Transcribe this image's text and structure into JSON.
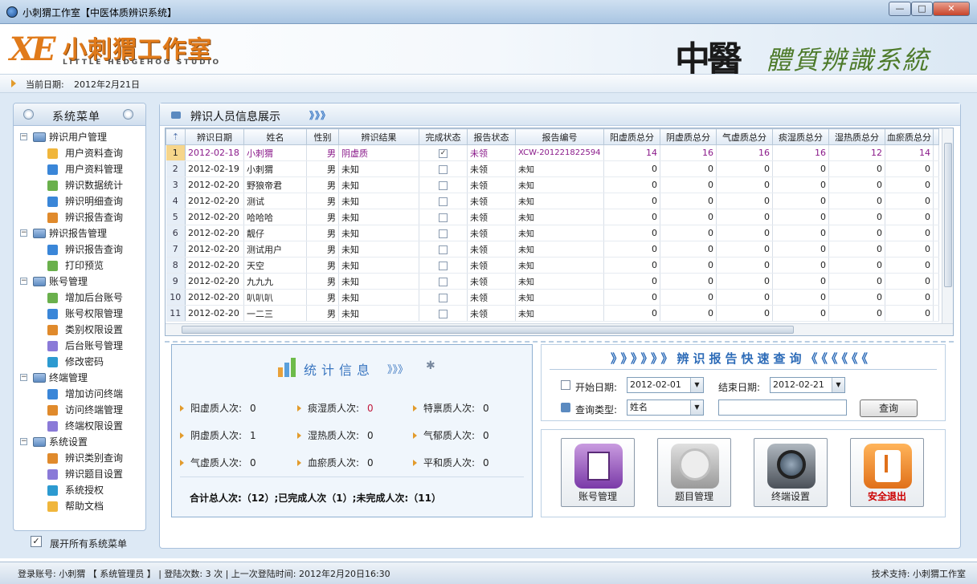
{
  "window": {
    "title": "小刺猬工作室【中医体质辨识系统】",
    "min": "—",
    "max": "□",
    "close": "✕"
  },
  "header": {
    "logo_mark": "XE",
    "logo_cn": "小刺猬工作室",
    "logo_en": "LITTLE HEDGEHOG STUDIO",
    "brand_1": "中醫",
    "brand_2": "體質辨識系統"
  },
  "datebar": {
    "label": "当前日期:",
    "value": "2012年2月21日"
  },
  "sidebar": {
    "title": "系统菜单",
    "groups": [
      {
        "label": "辨识用户管理",
        "items": [
          "用户资料查询",
          "用户资料管理",
          "辨识数据统计",
          "辨识明细查询",
          "辨识报告查询"
        ]
      },
      {
        "label": "辨识报告管理",
        "items": [
          "辨识报告查询",
          "打印预览"
        ]
      },
      {
        "label": "账号管理",
        "items": [
          "增加后台账号",
          "账号权限管理",
          "类别权限设置",
          "后台账号管理",
          "修改密码"
        ]
      },
      {
        "label": "终端管理",
        "items": [
          "增加访问终端",
          "访问终端管理",
          "终端权限设置"
        ]
      },
      {
        "label": "系统设置",
        "items": [
          "辨识类别查询",
          "辨识题目设置",
          "系统授权",
          "帮助文档"
        ]
      }
    ],
    "expand_all_label": "展开所有系统菜单",
    "expand_all_checked": true
  },
  "content": {
    "title": "辨识人员信息展示",
    "arrows": "》》》",
    "columns": [
      "辨识日期",
      "姓名",
      "性别",
      "辨识结果",
      "完成状态",
      "报告状态",
      "报告编号",
      "阳虚质总分",
      "阴虚质总分",
      "气虚质总分",
      "痰湿质总分",
      "湿热质总分",
      "血瘀质总分"
    ],
    "rows": [
      {
        "n": "1",
        "date": "2012-02-18",
        "name": "小刺猬",
        "sex": "男",
        "result": "阴虚质",
        "done": true,
        "report": "未领",
        "code": "XCW-201221822594",
        "s1": "14",
        "s2": "16",
        "s3": "16",
        "s4": "16",
        "s5": "12",
        "s6": "14"
      },
      {
        "n": "2",
        "date": "2012-02-19",
        "name": "小刺猬",
        "sex": "男",
        "result": "未知",
        "done": false,
        "report": "未领",
        "code": "未知",
        "s1": "0",
        "s2": "0",
        "s3": "0",
        "s4": "0",
        "s5": "0",
        "s6": "0"
      },
      {
        "n": "3",
        "date": "2012-02-20",
        "name": "野狼帝君",
        "sex": "男",
        "result": "未知",
        "done": false,
        "report": "未领",
        "code": "未知",
        "s1": "0",
        "s2": "0",
        "s3": "0",
        "s4": "0",
        "s5": "0",
        "s6": "0"
      },
      {
        "n": "4",
        "date": "2012-02-20",
        "name": "测试",
        "sex": "男",
        "result": "未知",
        "done": false,
        "report": "未领",
        "code": "未知",
        "s1": "0",
        "s2": "0",
        "s3": "0",
        "s4": "0",
        "s5": "0",
        "s6": "0"
      },
      {
        "n": "5",
        "date": "2012-02-20",
        "name": "哈哈哈",
        "sex": "男",
        "result": "未知",
        "done": false,
        "report": "未领",
        "code": "未知",
        "s1": "0",
        "s2": "0",
        "s3": "0",
        "s4": "0",
        "s5": "0",
        "s6": "0"
      },
      {
        "n": "6",
        "date": "2012-02-20",
        "name": "靓仔",
        "sex": "男",
        "result": "未知",
        "done": false,
        "report": "未领",
        "code": "未知",
        "s1": "0",
        "s2": "0",
        "s3": "0",
        "s4": "0",
        "s5": "0",
        "s6": "0"
      },
      {
        "n": "7",
        "date": "2012-02-20",
        "name": "测试用户",
        "sex": "男",
        "result": "未知",
        "done": false,
        "report": "未领",
        "code": "未知",
        "s1": "0",
        "s2": "0",
        "s3": "0",
        "s4": "0",
        "s5": "0",
        "s6": "0"
      },
      {
        "n": "8",
        "date": "2012-02-20",
        "name": "天空",
        "sex": "男",
        "result": "未知",
        "done": false,
        "report": "未领",
        "code": "未知",
        "s1": "0",
        "s2": "0",
        "s3": "0",
        "s4": "0",
        "s5": "0",
        "s6": "0"
      },
      {
        "n": "9",
        "date": "2012-02-20",
        "name": "九九九",
        "sex": "男",
        "result": "未知",
        "done": false,
        "report": "未领",
        "code": "未知",
        "s1": "0",
        "s2": "0",
        "s3": "0",
        "s4": "0",
        "s5": "0",
        "s6": "0"
      },
      {
        "n": "10",
        "date": "2012-02-20",
        "name": "叭叭叭",
        "sex": "男",
        "result": "未知",
        "done": false,
        "report": "未领",
        "code": "未知",
        "s1": "0",
        "s2": "0",
        "s3": "0",
        "s4": "0",
        "s5": "0",
        "s6": "0"
      },
      {
        "n": "11",
        "date": "2012-02-20",
        "name": "一二三",
        "sex": "男",
        "result": "未知",
        "done": false,
        "report": "未领",
        "code": "未知",
        "s1": "0",
        "s2": "0",
        "s3": "0",
        "s4": "0",
        "s5": "0",
        "s6": "0"
      }
    ]
  },
  "stats": {
    "title": "统计信息",
    "arrows": "》》》",
    "items": [
      {
        "label": "阳虚质人次:",
        "value": "0"
      },
      {
        "label": "痰湿质人次:",
        "value": "0"
      },
      {
        "label": "特禀质人次:",
        "value": "0"
      },
      {
        "label": "阴虚质人次:",
        "value": "1"
      },
      {
        "label": "湿热质人次:",
        "value": "0"
      },
      {
        "label": "气郁质人次:",
        "value": "0"
      },
      {
        "label": "气虚质人次:",
        "value": "0"
      },
      {
        "label": "血瘀质人次:",
        "value": "0"
      },
      {
        "label": "平和质人次:",
        "value": "0"
      }
    ],
    "total": "合计总人次:（12）;已完成人次（1）;未完成人次:（11）"
  },
  "query": {
    "title": "》》》》》》辨识报告快速查询《《《《《《",
    "start_label": "开始日期:",
    "start_value": "2012-02-01",
    "end_label": "结束日期:",
    "end_value": "2012-02-21",
    "type_label": "查询类型:",
    "type_value": "姓名",
    "search_button": "查询"
  },
  "quick": [
    {
      "label": "账号管理",
      "icon": "account-icon"
    },
    {
      "label": "题目管理",
      "icon": "question-icon"
    },
    {
      "label": "终端设置",
      "icon": "terminal-icon"
    },
    {
      "label": "安全退出",
      "icon": "exit-icon"
    }
  ],
  "status": {
    "left": "登录账号: 小刺猬 【 系统管理员 】 | 登陆次数: 3 次 | 上一次登陆时间: 2012年2月20日16:30",
    "right": "技术支持: 小刺猬工作室"
  },
  "colors": {
    "accent": "#3a76c0",
    "selected_row": "#8a1a8a",
    "logo": "#e07a1a",
    "exit_label": "#cc0000"
  }
}
